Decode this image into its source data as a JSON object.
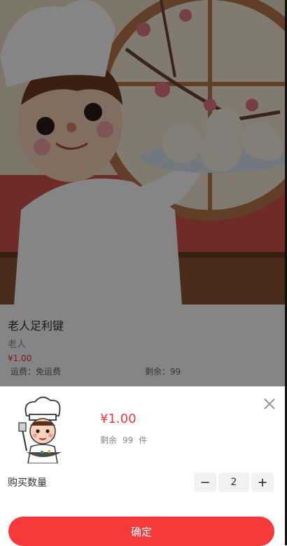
{
  "product": {
    "title": "老人足利键",
    "subtitle": "老人",
    "price": "¥1.00",
    "shipping": "运费：免运费",
    "stock": "剩余：99"
  },
  "sheet": {
    "price": "¥1.00",
    "stock_label": "剩余",
    "stock_value": "99",
    "stock_unit": "件",
    "quantity_label": "购买数量",
    "quantity_value": "2",
    "decrement": "−",
    "increment": "+",
    "confirm": "确定",
    "close_icon": "close-icon"
  },
  "colors": {
    "accent": "#f43a3a",
    "price": "#f23a3a",
    "stepper_bg": "#f1f2f4"
  }
}
